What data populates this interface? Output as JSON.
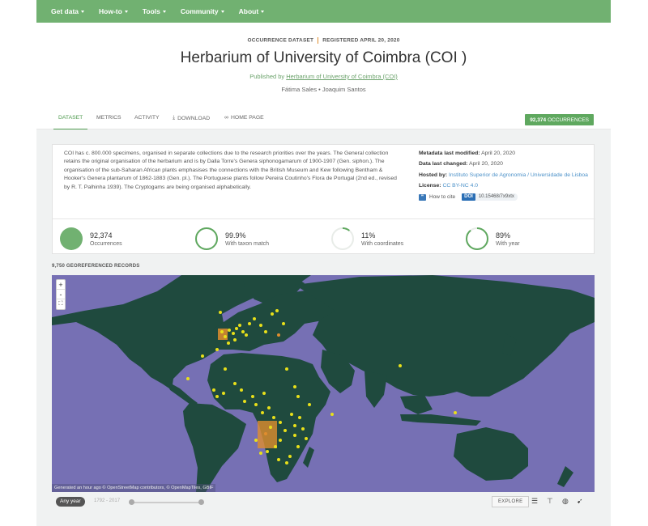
{
  "nav": {
    "items": [
      "Get data",
      "How-to",
      "Tools",
      "Community",
      "About"
    ]
  },
  "header": {
    "type_label": "OCCURRENCE DATASET",
    "registered": "REGISTERED APRIL 20, 2020",
    "title": "Herbarium of University of Coimbra (COI )",
    "published_prefix": "Published by ",
    "publisher": "Herbarium of University of Coimbra (COI)",
    "people": "Fátima Sales • Joaquim Santos"
  },
  "tabs": {
    "dataset": "DATASET",
    "metrics": "METRICS",
    "activity": "ACTIVITY",
    "download": "DOWNLOAD",
    "homepage": "HOME PAGE"
  },
  "occurrence_badge": {
    "count": "92,374",
    "label": "OCCURRENCES"
  },
  "description": "COI has c. 800.000 specimens, organised in separate collections due to the research priorities over the years. The General collection retains the original organisation of the herbarium and is by Dalla Torre's Genera siphonogamarum of 1900-1907 (Gen. siphon.). The organisation of the sub-Saharan African plants emphasises the connections with the British Museum and Kew following Bentham & Hooker's Genera plantarum of 1862-1883 (Gen. pl.). The Portuguese plants follow Pereira Coutinho's Flora de Portugal (2nd ed., revised by R. T. Palhinha 1939). The Cryptogams are being organised alphabetically.",
  "metadata": {
    "modified_label": "Metadata last modified:",
    "modified_value": "April 20, 2020",
    "changed_label": "Data last changed:",
    "changed_value": "April 20, 2020",
    "hosted_label": "Hosted by:",
    "hosted_value": "Instituto Superior de Agronomia / Universidade de Lisboa",
    "license_label": "License:",
    "license_value": "CC BY-NC 4.0",
    "cite_label": "How to cite",
    "doi_label": "DOI",
    "doi_value": "10.15468/7x9xtx"
  },
  "stats": [
    {
      "value": "92,374",
      "label": "Occurrences",
      "fraction": 1.0
    },
    {
      "value": "99.9%",
      "label": "With taxon match",
      "fraction": 0.999
    },
    {
      "value": "11%",
      "label": "With coordinates",
      "fraction": 0.11
    },
    {
      "value": "89%",
      "label": "With year",
      "fraction": 0.89
    }
  ],
  "colors": {
    "accent": "#71b171",
    "ring": "#5fa85f",
    "map_ocean": "#7670b4",
    "map_land": "#1f4a3e",
    "point_yellow": "#e8e01a",
    "point_orange": "#e08d2e"
  },
  "map": {
    "georef_label": "9,750 GEOREFERENCED RECORDS",
    "attribution": "Generated an hour ago © OpenStreetMap contributors, © OpenMapTiles, GBIF",
    "zoom_in": "+",
    "zoom_out": "-",
    "fullscreen": "⛶"
  },
  "controls": {
    "any_year": "Any year",
    "year_range": "1792 - 2017",
    "explore": "EXPLORE"
  }
}
